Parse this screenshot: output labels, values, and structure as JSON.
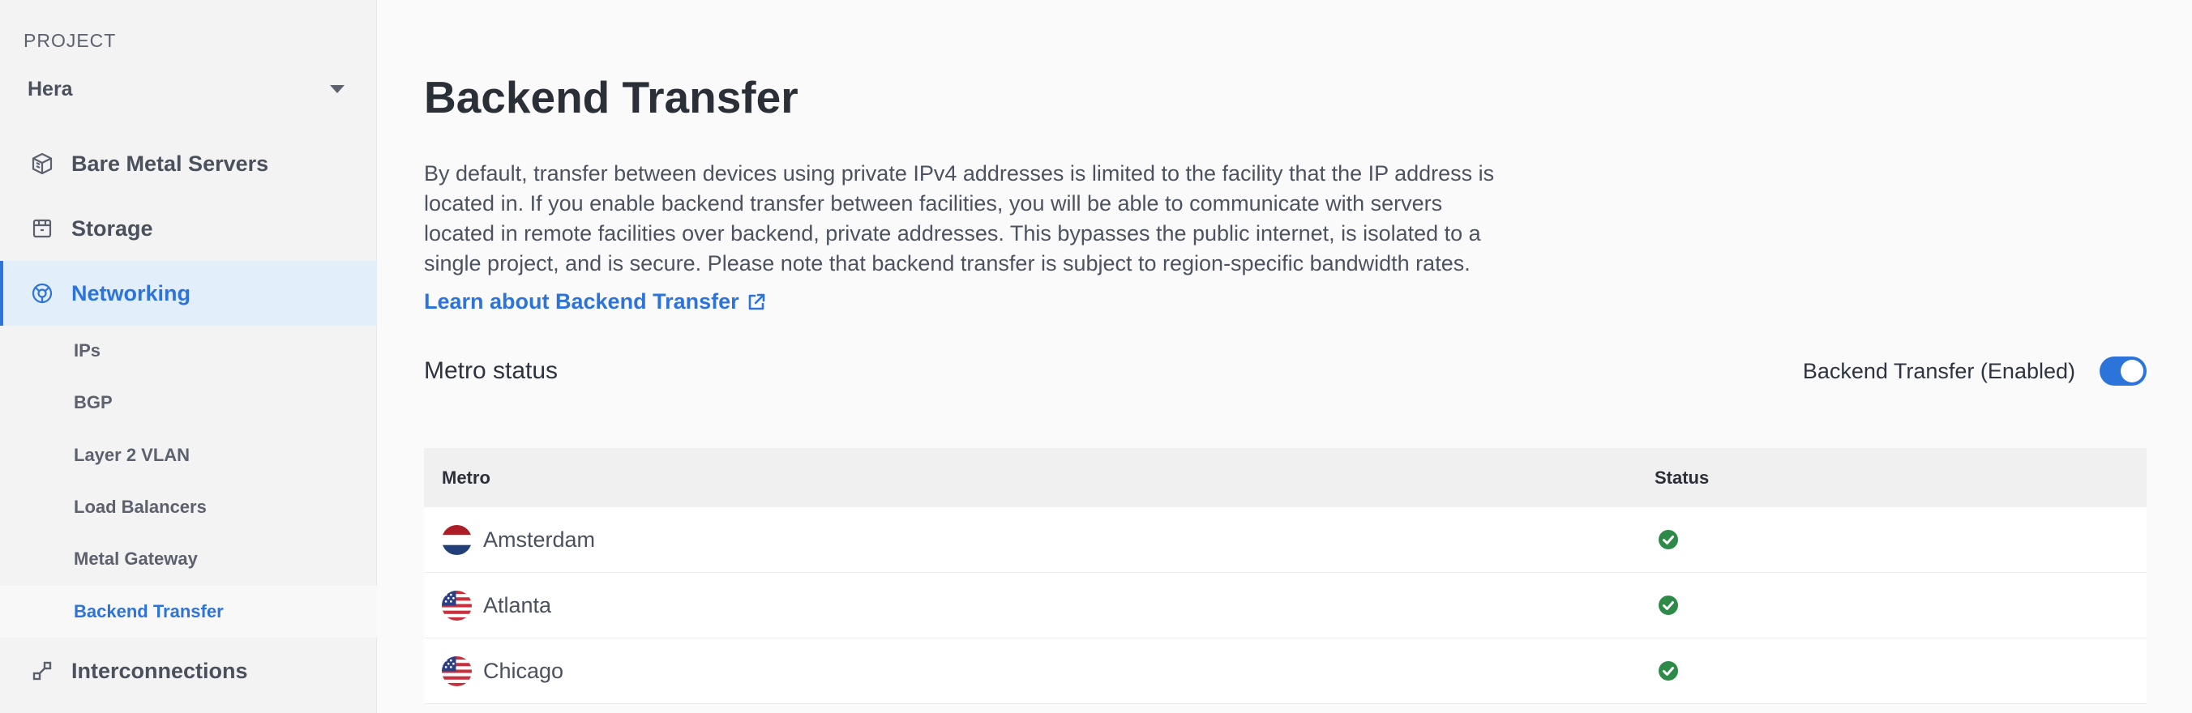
{
  "sidebar": {
    "project_label": "PROJECT",
    "project_name": "Hera",
    "items": [
      {
        "label": "Bare Metal Servers",
        "icon": "server-icon"
      },
      {
        "label": "Storage",
        "icon": "storage-icon"
      },
      {
        "label": "Networking",
        "icon": "networking-icon",
        "active": true
      },
      {
        "label": "Interconnections",
        "icon": "interconnection-icon"
      }
    ],
    "sub_items": [
      {
        "label": "IPs"
      },
      {
        "label": "BGP"
      },
      {
        "label": "Layer 2 VLAN"
      },
      {
        "label": "Load Balancers"
      },
      {
        "label": "Metal Gateway"
      },
      {
        "label": "Backend Transfer",
        "active": true
      }
    ]
  },
  "main": {
    "title": "Backend Transfer",
    "description_lines": [
      "By default, transfer between devices using private IPv4 addresses is limited to the facility that the IP address is",
      "located in. If you enable backend transfer between facilities, you will be able to communicate with servers",
      "located in remote facilities over backend, private addresses. This bypasses the public internet, is isolated to a",
      "single project, and is secure. Please note that backend transfer is subject to region-specific bandwidth rates."
    ],
    "learn_link": "Learn about Backend Transfer",
    "metro_status": "Metro status",
    "toggle_label": "Backend Transfer (Enabled)",
    "toggle_on": true
  },
  "table": {
    "headers": {
      "metro": "Metro",
      "status": "Status"
    },
    "rows": [
      {
        "metro": "Amsterdam",
        "flag": "netherlands-flag",
        "status": "enabled"
      },
      {
        "metro": "Atlanta",
        "flag": "us-flag",
        "status": "enabled"
      },
      {
        "metro": "Chicago",
        "flag": "us-flag",
        "status": "enabled"
      }
    ]
  },
  "colors": {
    "accent": "#2d74da",
    "success": "#2e8b47",
    "sidebar_bg": "#f3f3f4",
    "active_bg": "#e2eefa"
  }
}
